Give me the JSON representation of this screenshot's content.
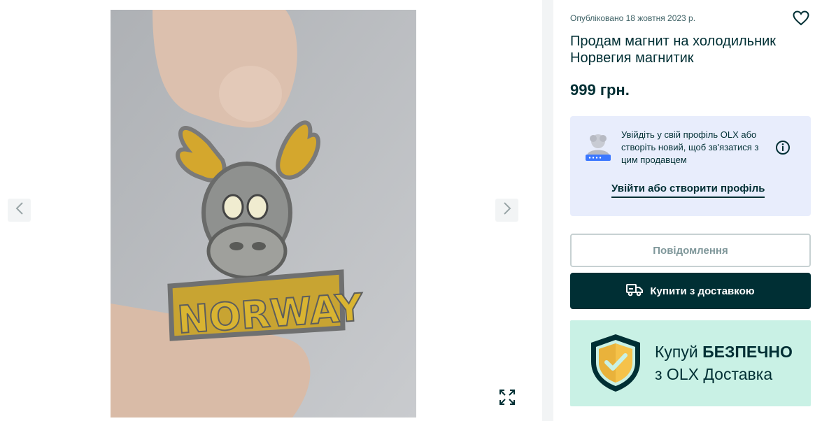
{
  "gallery": {
    "photo_alt": "NORWAY",
    "prev_icon": "chevron-left-icon",
    "next_icon": "chevron-right-icon",
    "fullscreen_icon": "expand-icon"
  },
  "ad": {
    "published": "Опубліковано 18 жовтня 2023 р.",
    "title": "Продам магнит на холодильник Норвегия магнитик",
    "price": "999 грн.",
    "favorite_icon": "heart-icon"
  },
  "login_prompt": {
    "text": "Увійдіть у свій профіль OLX або створіть новий, щоб зв'язатися з цим продавцем",
    "link": "Увійти або створити профіль",
    "info_icon": "info-icon"
  },
  "actions": {
    "message": "Повідомлення",
    "buy": "Купити з доставкою",
    "buy_icon": "truck-icon"
  },
  "promo": {
    "line1_prefix": "Купуй ",
    "line1_bold": "БЕЗПЕЧНО",
    "line2": "з OLX Доставка"
  },
  "colors": {
    "brand_dark": "#002f34",
    "login_bg": "#e8edfc",
    "promo_bg": "#c9f1e5",
    "shield_gold": "#f5c24a"
  }
}
